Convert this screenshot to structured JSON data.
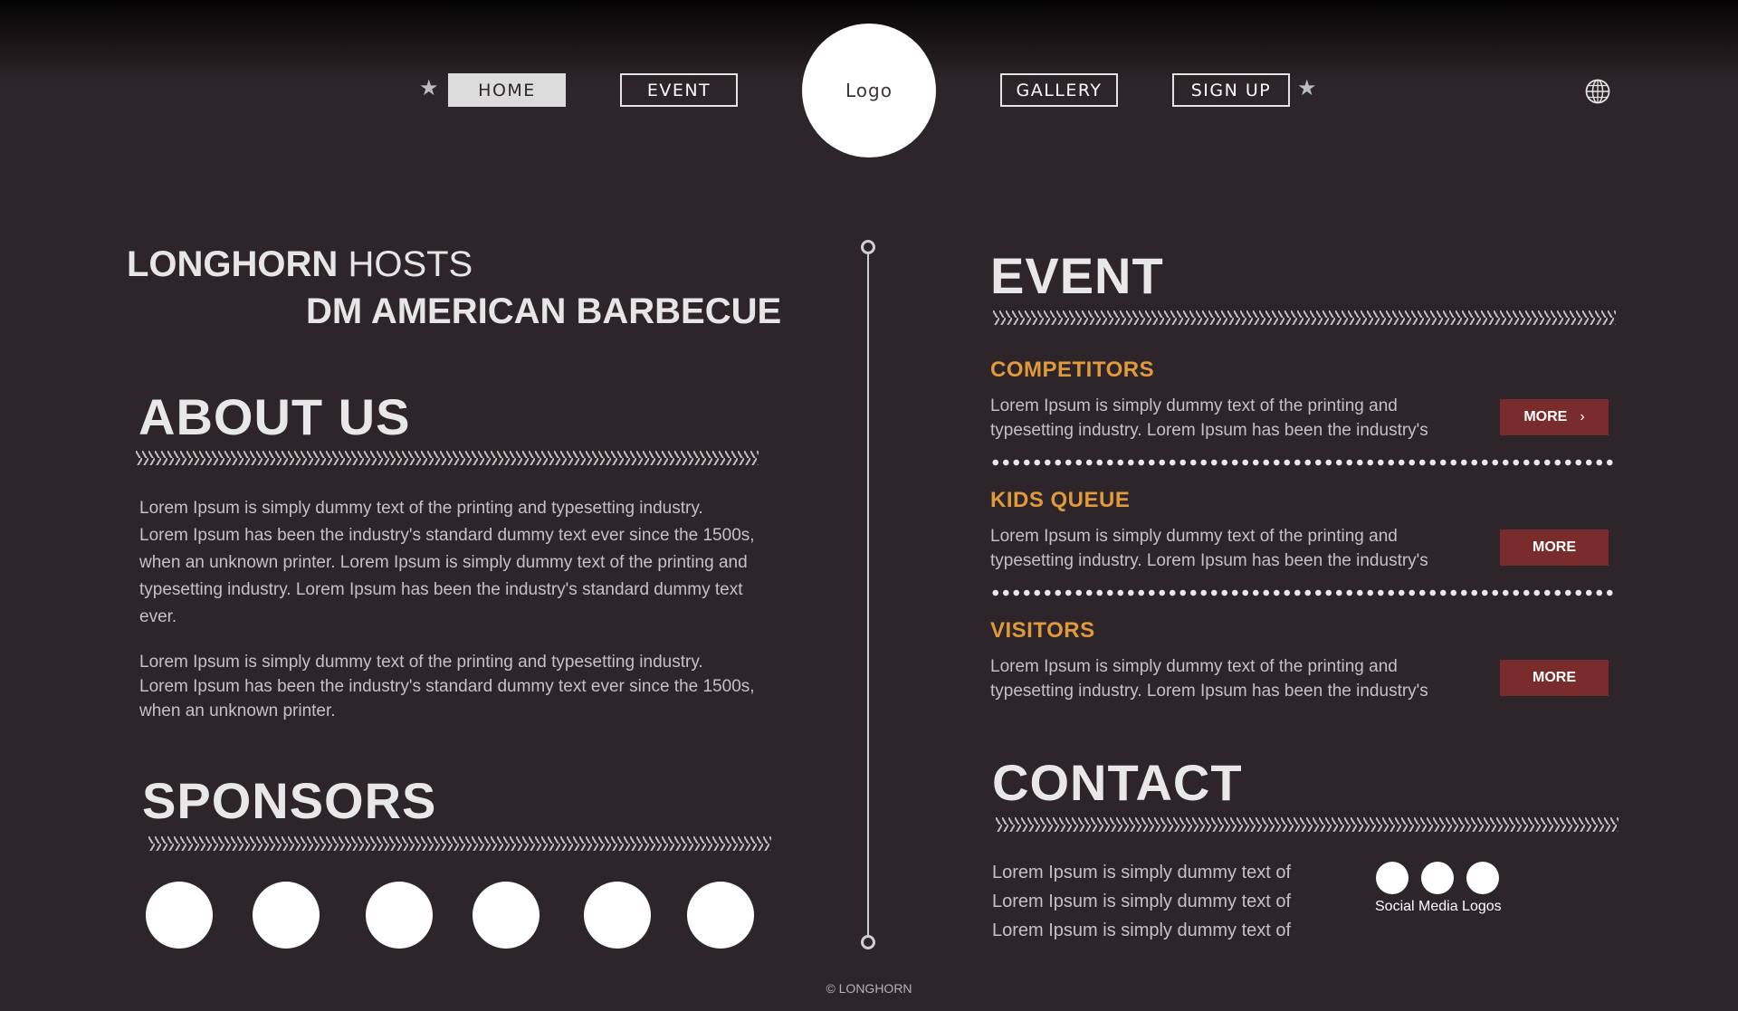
{
  "nav": {
    "home": "HOME",
    "event": "EVENT",
    "logo": "Logo",
    "gallery": "GALLERY",
    "signup": "SIGN UP"
  },
  "hero": {
    "line1_bold": "LONGHORN",
    "line1_rest": " HOSTS",
    "line2": "DM AMERICAN BARBECUE"
  },
  "about": {
    "title": "ABOUT US",
    "p1": "Lorem Ipsum is simply dummy text of the printing and typesetting industry. Lorem Ipsum has been the industry's standard dummy text ever since the 1500s, when an unknown printer. Lorem Ipsum is simply dummy text of the printing and typesetting industry. Lorem Ipsum has been the industry's standard dummy text ever.",
    "p2": "Lorem Ipsum is simply dummy text of the printing and typesetting industry. Lorem Ipsum has been the industry's standard dummy text ever since the 1500s, when an unknown printer."
  },
  "sponsors": {
    "title": "SPONSORS"
  },
  "event": {
    "title": "EVENT",
    "items": [
      {
        "title": "COMPETITORS",
        "text": "Lorem Ipsum is simply dummy text of the printing and typesetting industry. Lorem Ipsum has been the industry's",
        "more": "MORE",
        "arrow": "›"
      },
      {
        "title": "KIDS QUEUE",
        "text": "Lorem Ipsum is simply dummy text of the printing and typesetting industry. Lorem Ipsum has been the industry's",
        "more": "MORE"
      },
      {
        "title": "VISITORS",
        "text": "Lorem Ipsum is simply dummy text of the printing and typesetting industry. Lorem Ipsum has been the industry's",
        "more": "MORE"
      }
    ]
  },
  "contact": {
    "title": "CONTACT",
    "lines": [
      "Lorem Ipsum is simply dummy text of",
      "Lorem Ipsum is simply dummy text of",
      "Lorem Ipsum is simply dummy text of"
    ],
    "social_label": "Social Media Logos"
  },
  "footer": "© LONGHORN",
  "colors": {
    "background": "#2d2529",
    "accent_orange": "#e09a3c",
    "more_button": "#7a2b2b"
  },
  "icons": [
    "star-icon",
    "globe-icon"
  ]
}
